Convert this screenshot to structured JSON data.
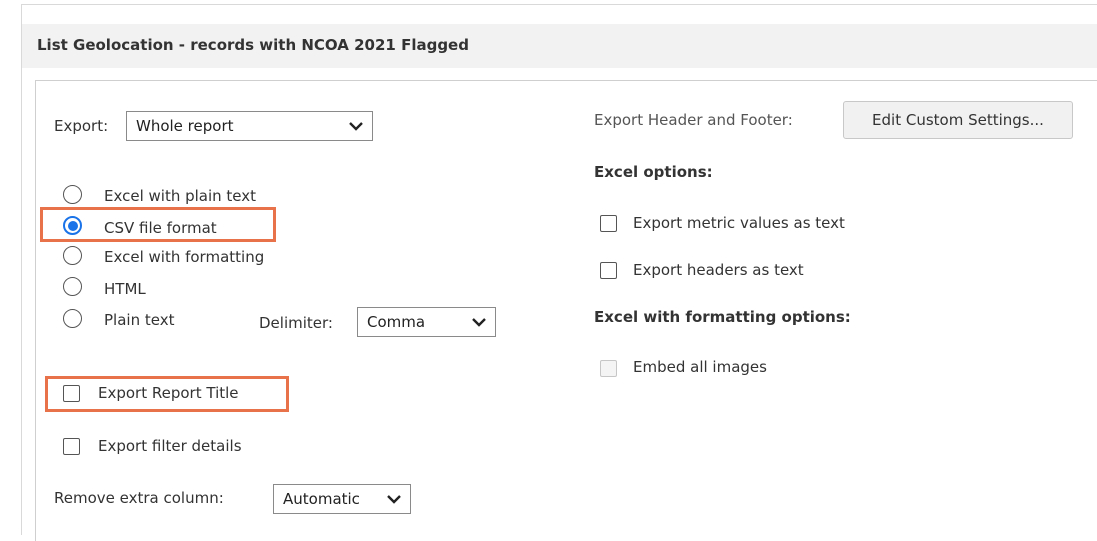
{
  "page": {
    "title": "List Geolocation - records with NCOA 2021 Flagged"
  },
  "export": {
    "label": "Export:",
    "selected": "Whole report"
  },
  "formats": [
    {
      "label": "Excel with plain text",
      "checked": false
    },
    {
      "label": "CSV file format",
      "checked": true
    },
    {
      "label": "Excel with formatting",
      "checked": false
    },
    {
      "label": "HTML",
      "checked": false
    },
    {
      "label": "Plain text",
      "checked": false
    }
  ],
  "delimiter": {
    "label": "Delimiter:",
    "selected": "Comma"
  },
  "checkboxes": {
    "report_title": {
      "label": "Export Report Title",
      "checked": false
    },
    "filter_details": {
      "label": "Export filter details",
      "checked": false
    }
  },
  "remove_column": {
    "label": "Remove extra column:",
    "selected": "Automatic"
  },
  "header_footer": {
    "label": "Export Header and Footer:",
    "button_label": "Edit Custom Settings..."
  },
  "excel_options": {
    "heading": "Excel options:",
    "metric_values": {
      "label": "Export metric values as text",
      "checked": false
    },
    "headers_text": {
      "label": "Export headers as text",
      "checked": false
    }
  },
  "excel_formatting_options": {
    "heading": "Excel with formatting options:",
    "embed_images": {
      "label": "Embed all images",
      "checked": false,
      "disabled": true
    }
  },
  "colors": {
    "accent": "#1a73e8",
    "highlight": "#e8734a",
    "title_bar": "#f2f2f2"
  },
  "icons": {
    "dropdown": "chevron-down-icon"
  }
}
